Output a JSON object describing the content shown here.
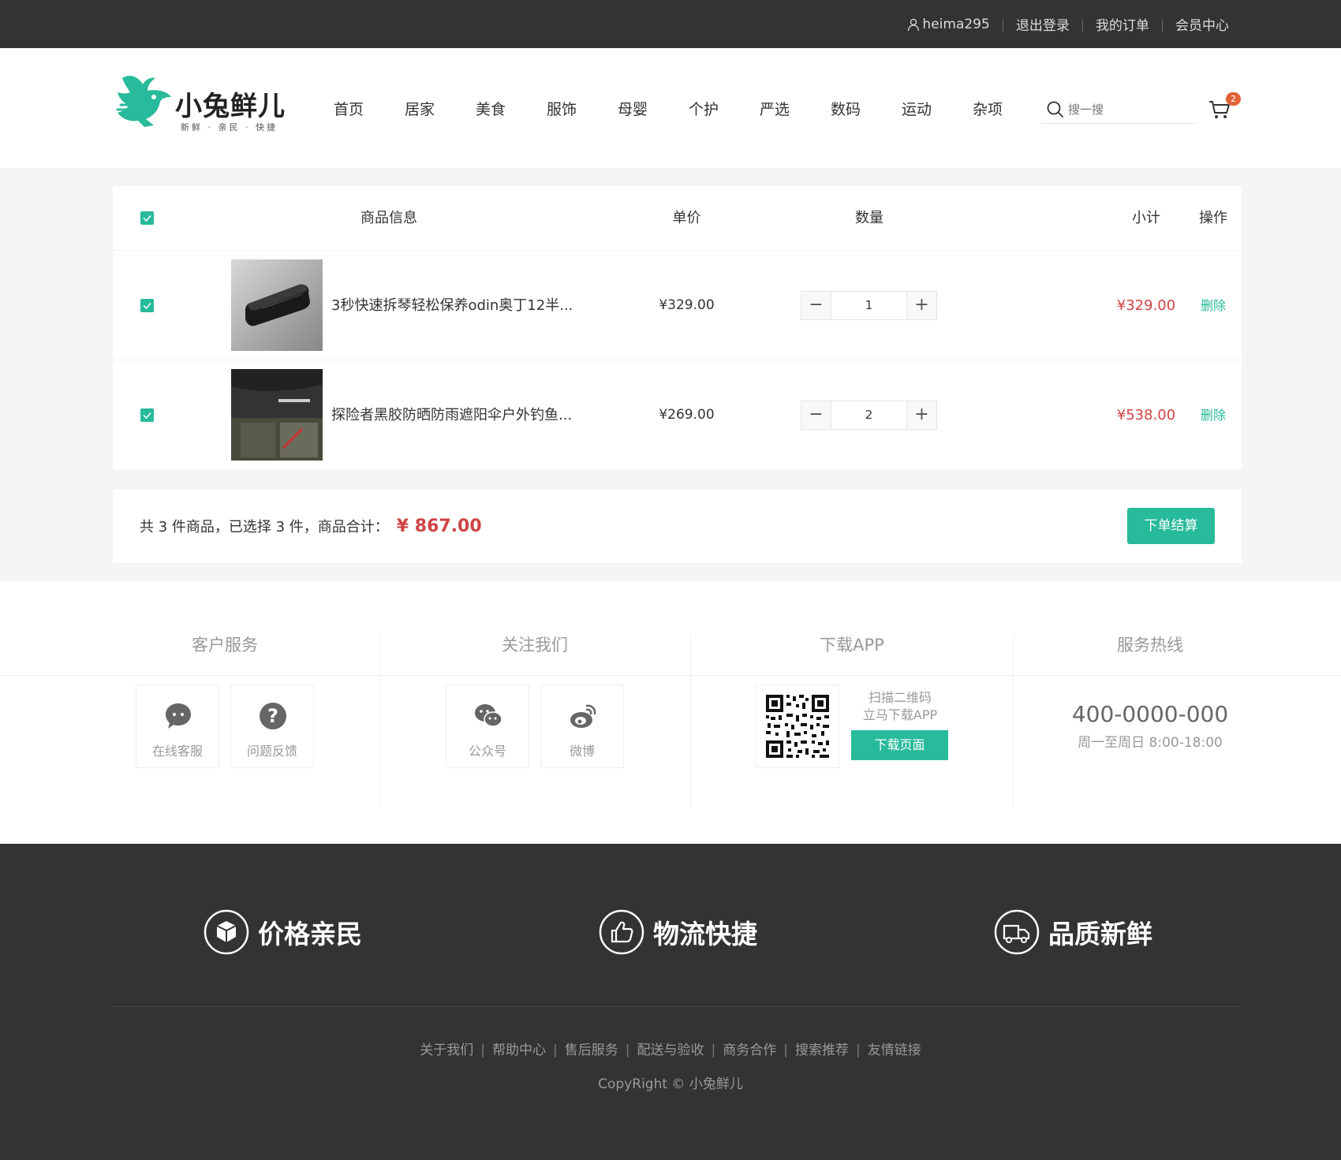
{
  "topbar": {
    "username": "heima295",
    "logout": "退出登录",
    "orders": "我的订单",
    "member": "会员中心",
    "separator": "|"
  },
  "logo": {
    "name": "小兔鲜儿",
    "slogan": "新鲜 · 亲民 · 快捷"
  },
  "nav": [
    "首页",
    "居家",
    "美食",
    "服饰",
    "母婴",
    "个护",
    "严选",
    "数码",
    "运动",
    "杂项"
  ],
  "search": {
    "placeholder": "搜一搜"
  },
  "cart_badge": "2",
  "table": {
    "headers": [
      "商品信息",
      "单价",
      "数量",
      "小计",
      "操作"
    ],
    "rows": [
      {
        "name": "3秒快速拆琴轻松保养odin奥丁12半...",
        "price": "¥329.00",
        "qty": "1",
        "subtotal": "¥329.00",
        "action": "删除"
      },
      {
        "name": "探险者黑胶防晒防雨遮阳伞户外钓鱼...",
        "price": "¥269.00",
        "qty": "2",
        "subtotal": "¥538.00",
        "action": "删除"
      }
    ],
    "minus": "−",
    "plus": "+"
  },
  "summary": {
    "text": "共 3 件商品，已选择 3 件，商品合计：",
    "total": "¥ 867.00",
    "checkout": "下单结算"
  },
  "service": {
    "titles": [
      "客户服务",
      "关注我们",
      "下载APP",
      "服务热线"
    ],
    "boxes": [
      {
        "label": "在线客服",
        "icon": "chat-bubble-icon"
      },
      {
        "label": "问题反馈",
        "icon": "question-icon"
      },
      {
        "label": "公众号",
        "icon": "wechat-icon"
      },
      {
        "label": "微博",
        "icon": "weibo-icon"
      }
    ],
    "qr_text_1": "扫描二维码",
    "qr_text_2": "立马下载APP",
    "download_btn": "下载页面",
    "hotline": "400-0000-000",
    "hours": "周一至周日 8:00-18:00"
  },
  "footer": {
    "promises": [
      "价格亲民",
      "物流快捷",
      "品质新鲜"
    ],
    "links": [
      "关于我们",
      "帮助中心",
      "售后服务",
      "配送与验收",
      "商务合作",
      "搜索推荐",
      "友情链接"
    ],
    "copyright": "CopyRight © 小兔鲜儿"
  },
  "colors": {
    "accent": "#27ba9b",
    "price_red": "#cf4444",
    "topbar": "#333333",
    "badge": "#e26237"
  }
}
